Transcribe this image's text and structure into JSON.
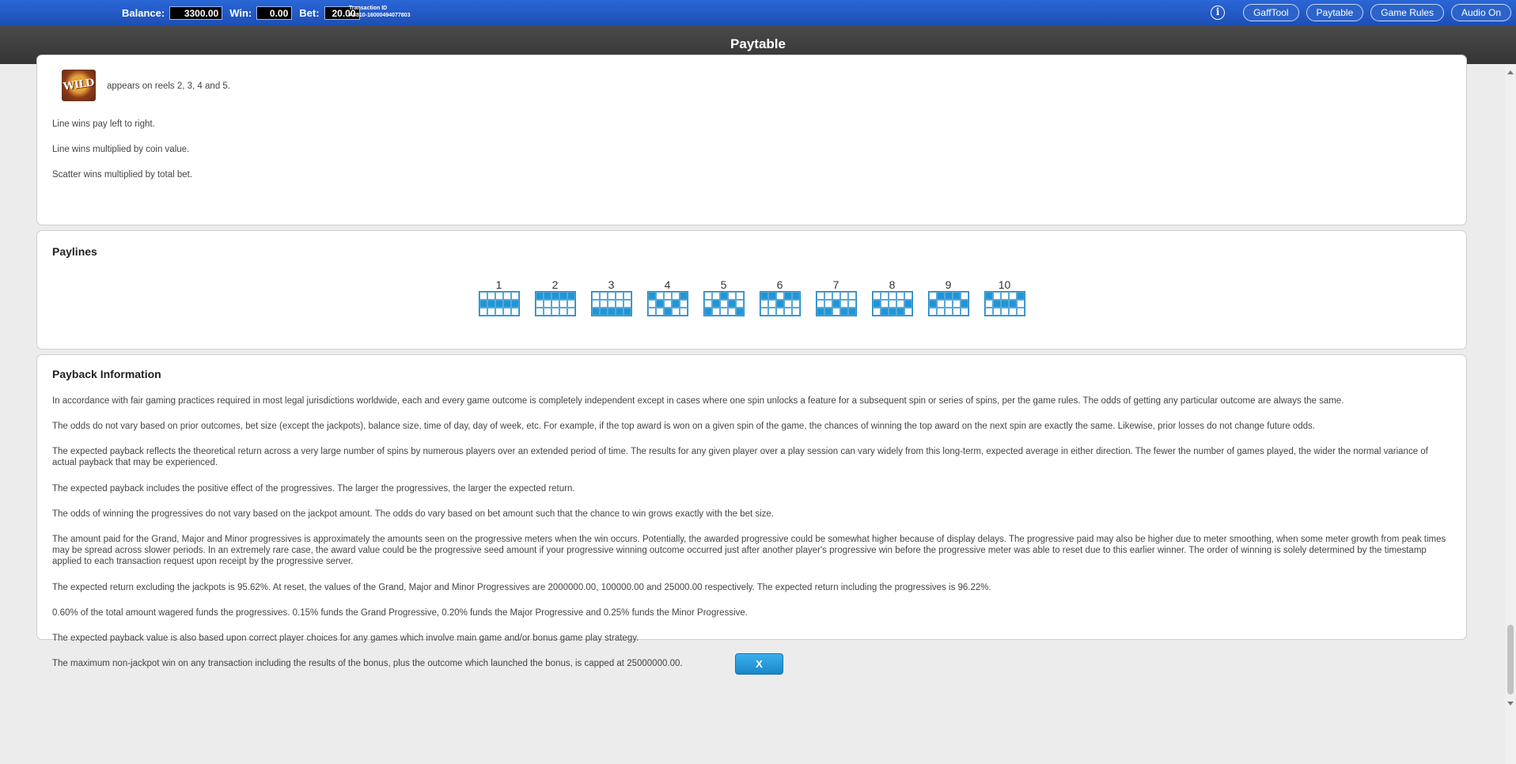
{
  "topbar": {
    "balance_label": "Balance:",
    "balance_value": "3300.00",
    "win_label": "Win:",
    "win_value": "0.00",
    "bet_label": "Bet:",
    "bet_value": "20.00",
    "transaction_label": "Transaction ID",
    "transaction_value": "A8810-16000494077803",
    "info_icon": "i",
    "buttons": [
      "GaffTool",
      "Paytable",
      "Game Rules",
      "Audio On"
    ]
  },
  "title": "Paytable",
  "rules_panel": {
    "wild_symbol_text": "WILD",
    "wild_text": "appears on reels 2, 3, 4 and 5.",
    "lines": [
      "Line wins pay left to right.",
      "Line wins multiplied by coin value.",
      "Scatter wins multiplied by total bet."
    ]
  },
  "paylines_panel": {
    "heading": "Paylines",
    "paylines": [
      {
        "label": "1",
        "rows": [
          1,
          1,
          1,
          1,
          1
        ]
      },
      {
        "label": "2",
        "rows": [
          0,
          0,
          0,
          0,
          0
        ]
      },
      {
        "label": "3",
        "rows": [
          2,
          2,
          2,
          2,
          2
        ]
      },
      {
        "label": "4",
        "rows": [
          0,
          1,
          2,
          1,
          0
        ]
      },
      {
        "label": "5",
        "rows": [
          2,
          1,
          0,
          1,
          2
        ]
      },
      {
        "label": "6",
        "rows": [
          0,
          0,
          1,
          0,
          0
        ]
      },
      {
        "label": "7",
        "rows": [
          2,
          2,
          1,
          2,
          2
        ]
      },
      {
        "label": "8",
        "rows": [
          1,
          2,
          2,
          2,
          1
        ]
      },
      {
        "label": "9",
        "rows": [
          1,
          0,
          0,
          0,
          1
        ]
      },
      {
        "label": "10",
        "rows": [
          0,
          1,
          1,
          1,
          0
        ]
      }
    ]
  },
  "payback_panel": {
    "heading": "Payback Information",
    "paragraphs": [
      "In accordance with fair gaming practices required in most legal jurisdictions worldwide, each and every game outcome is completely independent except in cases where one spin unlocks a feature for a subsequent spin or series of spins, per the game rules. The odds of getting any particular outcome are always the same.",
      "The odds do not vary based on prior outcomes, bet size (except the jackpots), balance size, time of day, day of week, etc. For example, if the top award is won on a given spin of the game, the chances of winning the top award on the next spin are exactly the same. Likewise, prior losses do not change future odds.",
      "The expected payback reflects the theoretical return across a very large number of spins by numerous players over an extended period of time. The results for any given player over a play session can vary widely from this long-term, expected average in either direction. The fewer the number of games played, the wider the normal variance of actual payback that may be experienced.",
      "The expected payback includes the positive effect of the progressives. The larger the progressives, the larger the expected return.",
      "The odds of winning the progressives do not vary based on the jackpot amount. The odds do vary based on bet amount such that the chance to win grows exactly with the bet size.",
      "The amount paid for the Grand, Major and Minor progressives is approximately the amounts seen on the progressive meters when the win occurs. Potentially, the awarded progressive could be somewhat higher because of display delays. The progressive paid may also be higher due to meter smoothing, when some meter growth from peak times may be spread across slower periods. In an extremely rare case, the award value could be the progressive seed amount if your progressive winning outcome occurred just after another player's progressive win before the progressive meter was able to reset due to this earlier winner. The order of winning is solely determined by the timestamp applied to each transaction request upon receipt by the progressive server.",
      "The expected return excluding the jackpots is 95.62%. At reset, the values of the Grand, Major and Minor Progressives are 2000000.00, 100000.00 and 25000.00 respectively. The expected return including the progressives is 96.22%.",
      "0.60% of the total amount wagered funds the progressives. 0.15% funds the Grand Progressive, 0.20% funds the Major Progressive and 0.25% funds the Minor Progressive.",
      "The expected payback value is also based upon correct player choices for any games which involve main game and/or bonus game play strategy.",
      "The maximum non-jackpot win on any transaction including the results of the bonus, plus the outcome which launched the bonus, is capped at 25000000.00."
    ]
  },
  "close_button": "X",
  "colors": {
    "topbar": "#1d4fb5",
    "titlebar": "#3d3d3d",
    "payline_cell": "#1e96d6",
    "close_button": "#1b86c9"
  }
}
